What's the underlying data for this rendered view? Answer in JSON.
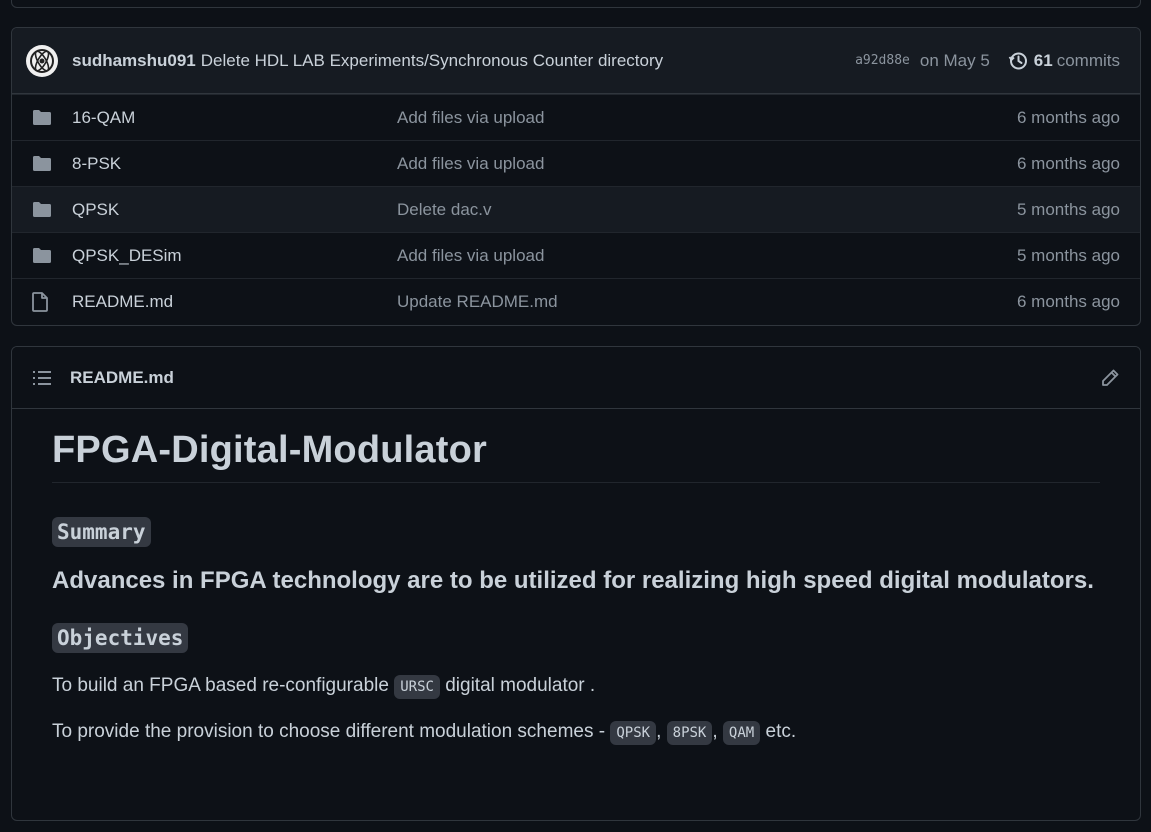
{
  "commit": {
    "author": "sudhamshu091",
    "message": "Delete HDL LAB Experiments/Synchronous Counter directory",
    "sha": "a92d88e",
    "date": "on May 5",
    "count": "61",
    "count_label": "commits"
  },
  "files": [
    {
      "name": "16-QAM",
      "type": "folder",
      "commit": "Add files via upload",
      "age": "6 months ago"
    },
    {
      "name": "8-PSK",
      "type": "folder",
      "commit": "Add files via upload",
      "age": "6 months ago"
    },
    {
      "name": "QPSK",
      "type": "folder",
      "commit": "Delete dac.v",
      "age": "5 months ago"
    },
    {
      "name": "QPSK_DESim",
      "type": "folder",
      "commit": "Add files via upload",
      "age": "5 months ago"
    },
    {
      "name": "README.md",
      "type": "file",
      "commit": "Update README.md",
      "age": "6 months ago"
    }
  ],
  "readme": {
    "filename": "README.md",
    "title": "FPGA-Digital-Modulator",
    "summary_heading": "Summary",
    "summary_text": "Advances in FPGA technology are to be utilized for realizing high speed digital modulators.",
    "objectives_heading": "Objectives",
    "objective1_pre": "To build an FPGA based re-configurable ",
    "objective1_code": "URSC",
    "objective1_post": " digital modulator .",
    "objective2_pre": "To provide the provision to choose different modulation schemes - ",
    "objective2_code1": "QPSK",
    "objective2_sep1": ", ",
    "objective2_code2": "8PSK",
    "objective2_sep2": ", ",
    "objective2_code3": "QAM",
    "objective2_post": " etc."
  },
  "colors": {
    "background": "#0d1117",
    "border": "#30363d",
    "text": "#c9d1d9",
    "muted": "#8b949e"
  }
}
